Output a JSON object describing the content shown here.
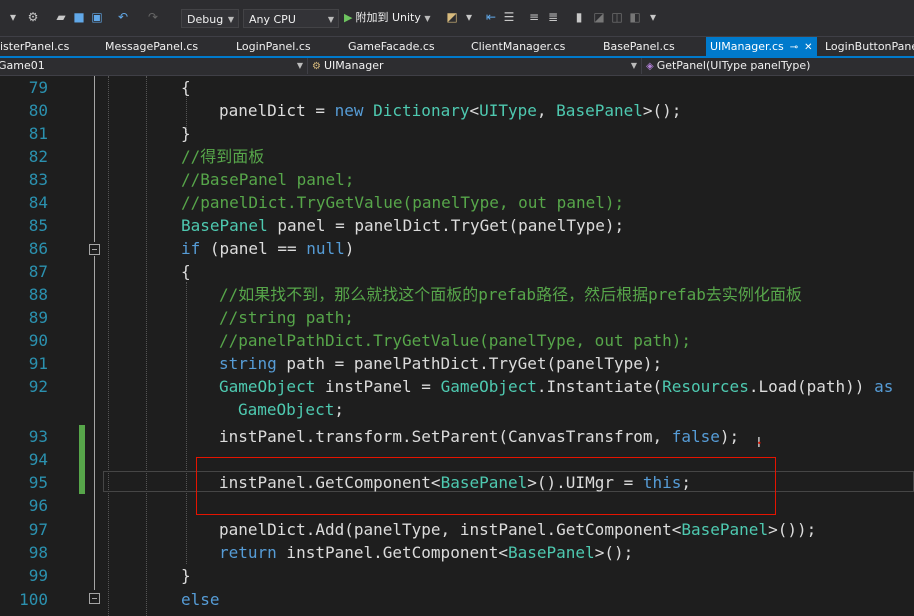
{
  "toolbar": {
    "config": "Debug",
    "platform": "Any CPU",
    "run_label": "附加到 Unity"
  },
  "tabs": [
    {
      "label": "isterPanel.cs"
    },
    {
      "label": "MessagePanel.cs"
    },
    {
      "label": "LoginPanel.cs"
    },
    {
      "label": "GameFacade.cs"
    },
    {
      "label": "ClientManager.cs"
    },
    {
      "label": "BasePanel.cs"
    },
    {
      "label": "UIManager.cs",
      "active": true
    },
    {
      "label": "LoginButtonPanel.cs"
    }
  ],
  "navbar": {
    "project": "Game01",
    "class": "UIManager",
    "member": "GetPanel(UIType panelType)"
  },
  "code_lines": [
    {
      "n": "79"
    },
    {
      "n": "80"
    },
    {
      "n": "81"
    },
    {
      "n": "82"
    },
    {
      "n": "83"
    },
    {
      "n": "84"
    },
    {
      "n": "85"
    },
    {
      "n": "86"
    },
    {
      "n": "87"
    },
    {
      "n": "88"
    },
    {
      "n": "89"
    },
    {
      "n": "90"
    },
    {
      "n": "91"
    },
    {
      "n": "92"
    },
    {
      "n": "93"
    },
    {
      "n": "94"
    },
    {
      "n": "95"
    },
    {
      "n": "96"
    },
    {
      "n": "97"
    },
    {
      "n": "98"
    },
    {
      "n": "99"
    },
    {
      "n": "100"
    }
  ],
  "code": {
    "l79": "{",
    "l80_a": "panelDict = ",
    "l80_new": "new",
    "l80_b": " ",
    "l80_dict": "Dictionary",
    "l80_c": "<",
    "l80_uitype": "UIType",
    "l80_d": ", ",
    "l80_bp": "BasePanel",
    "l80_e": ">();",
    "l81": "}",
    "l82": "//得到面板",
    "l83": "//BasePanel panel;",
    "l84": "//panelDict.TryGetValue(panelType, out panel);",
    "l85_bp": "BasePanel",
    "l85_rest": " panel = panelDict.TryGet(panelType);",
    "l86_if": "if",
    "l86_a": " (panel == ",
    "l86_null": "null",
    "l86_b": ")",
    "l87": "{",
    "l88": "//如果找不到，那么就找这个面板的prefab路径，然后根据prefab去实例化面板",
    "l89": "//string path;",
    "l90": "//panelPathDict.TryGetValue(panelType, out path);",
    "l91_str": "string",
    "l91_rest": " path = panelPathDict.TryGet(panelType);",
    "l92_go": "GameObject",
    "l92_a": " instPanel = ",
    "l92_go2": "GameObject",
    "l92_b": ".Instantiate(",
    "l92_res": "Resources",
    "l92_c": ".Load(path)) ",
    "l92_as": "as",
    "l92w_go": "GameObject",
    "l92w_b": ";",
    "l93": "instPanel.transform.SetParent(CanvasTransfrom, ",
    "l93_false": "false",
    "l93_b": ");",
    "l95_a": "instPanel.GetComponent<",
    "l95_bp": "BasePanel",
    "l95_b": ">().UIMgr = ",
    "l95_this": "this",
    "l95_c": ";",
    "l97_a": "panelDict.Add(panelType, instPanel.GetComponent<",
    "l97_bp": "BasePanel",
    "l97_b": ">());",
    "l98_ret": "return",
    "l98_a": " instPanel.GetComponent<",
    "l98_bp": "BasePanel",
    "l98_b": ">();",
    "l99": "}",
    "l100": "else"
  }
}
